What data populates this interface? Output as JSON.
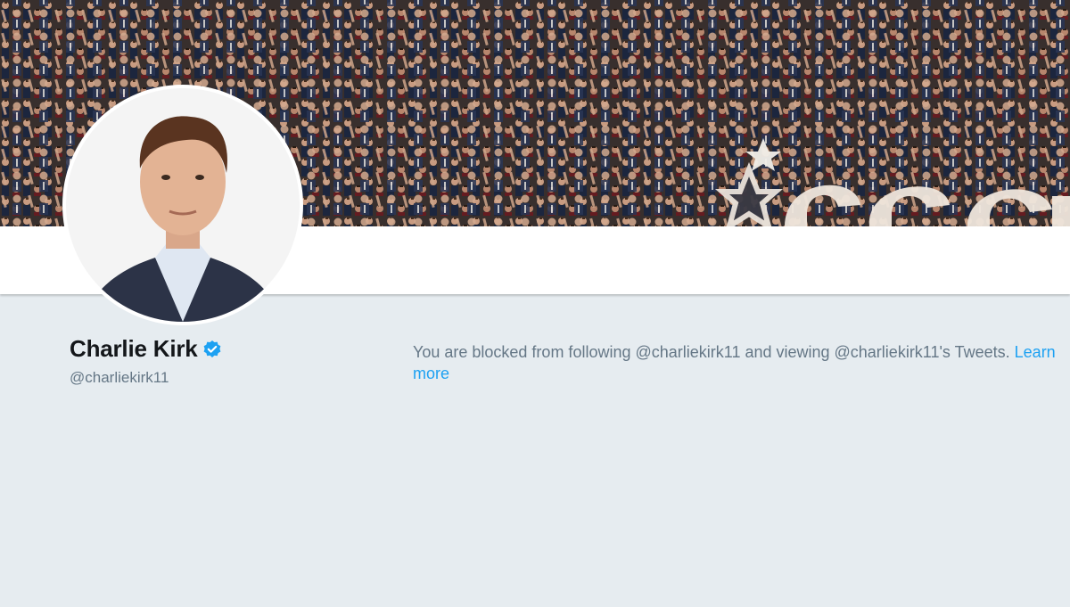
{
  "profile": {
    "name": "Charlie Kirk",
    "screen_name": "@charliekirk11",
    "verified": true,
    "verified_color": "#1da1f2"
  },
  "banner": {
    "icon": "crowd-photo"
  },
  "blocked_notice": {
    "text": "You are blocked from following @charliekirk11 and viewing @charliekirk11's Tweets.",
    "link_label": "Learn more",
    "link_color": "#1da1f2"
  },
  "theme": {
    "page_background": "#e6ecf0",
    "card_background": "#ffffff",
    "text_primary": "#14171a",
    "text_secondary": "#657786"
  }
}
